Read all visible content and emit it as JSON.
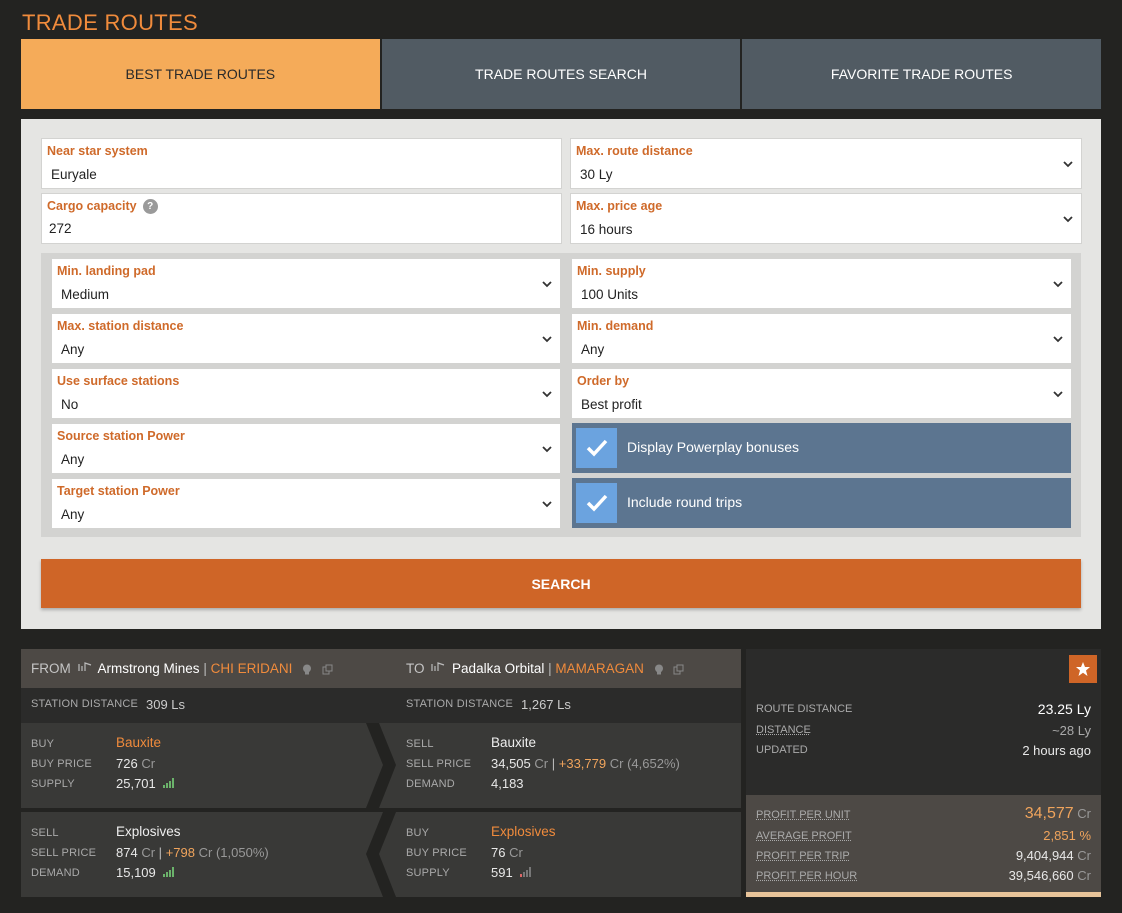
{
  "page_title": "TRADE ROUTES",
  "tabs": [
    {
      "label": "BEST TRADE ROUTES",
      "active": true
    },
    {
      "label": "TRADE ROUTES SEARCH",
      "active": false
    },
    {
      "label": "FAVORITE TRADE ROUTES",
      "active": false
    }
  ],
  "form": {
    "near_star_system": {
      "label": "Near star system",
      "value": "Euryale"
    },
    "max_route_distance": {
      "label": "Max. route distance",
      "value": "30 Ly"
    },
    "cargo_capacity": {
      "label": "Cargo capacity",
      "value": "272",
      "help": "?"
    },
    "max_price_age": {
      "label": "Max. price age",
      "value": "16 hours"
    },
    "min_landing_pad": {
      "label": "Min. landing pad",
      "value": "Medium"
    },
    "min_supply": {
      "label": "Min. supply",
      "value": "100 Units"
    },
    "max_station_distance": {
      "label": "Max. station distance",
      "value": "Any"
    },
    "min_demand": {
      "label": "Min. demand",
      "value": "Any"
    },
    "use_surface_stations": {
      "label": "Use surface stations",
      "value": "No"
    },
    "order_by": {
      "label": "Order by",
      "value": "Best profit"
    },
    "source_station_power": {
      "label": "Source station Power",
      "value": "Any"
    },
    "target_station_power": {
      "label": "Target station Power",
      "value": "Any"
    },
    "display_powerplay": {
      "label": "Display Powerplay bonuses",
      "checked": true
    },
    "include_round_trips": {
      "label": "Include round trips",
      "checked": true
    },
    "search_label": "SEARCH"
  },
  "route": {
    "from": {
      "prefix": "FROM",
      "station": "Armstrong Mines",
      "system": "CHI ERIDANI",
      "distance_label": "STATION DISTANCE",
      "distance": "309 Ls"
    },
    "to": {
      "prefix": "TO",
      "station": "Padalka Orbital",
      "system": "MAMARAGAN",
      "distance_label": "STATION DISTANCE",
      "distance": "1,267 Ls"
    },
    "leg1": {
      "left": {
        "action": "BUY",
        "commodity": "Bauxite",
        "price_label": "BUY PRICE",
        "price": "726",
        "amount_label": "SUPPLY",
        "amount": "25,701"
      },
      "right": {
        "action": "SELL",
        "commodity": "Bauxite",
        "price_label": "SELL PRICE",
        "price": "34,505",
        "profit": "+33,779",
        "profit_pct": "(4,652%)",
        "amount_label": "DEMAND",
        "amount": "4,183"
      }
    },
    "leg2": {
      "left": {
        "action": "SELL",
        "commodity": "Explosives",
        "price_label": "SELL PRICE",
        "price": "874",
        "profit": "+798",
        "profit_pct": "(1,050%)",
        "amount_label": "DEMAND",
        "amount": "15,109"
      },
      "right": {
        "action": "BUY",
        "commodity": "Explosives",
        "price_label": "BUY PRICE",
        "price": "76",
        "amount_label": "SUPPLY",
        "amount": "591"
      }
    },
    "currency": "Cr",
    "summary": {
      "route_distance_label": "ROUTE DISTANCE",
      "route_distance": "23.25 Ly",
      "distance_label": "DISTANCE",
      "distance": "~28 Ly",
      "updated_label": "UPDATED",
      "updated": "2 hours ago",
      "profit_per_unit_label": "PROFIT PER UNIT",
      "profit_per_unit": "34,577",
      "average_profit_label": "AVERAGE PROFIT",
      "average_profit": "2,851 %",
      "profit_per_trip_label": "PROFIT PER TRIP",
      "profit_per_trip": "9,404,944",
      "profit_per_hour_label": "PROFIT PER HOUR",
      "profit_per_hour": "39,546,660"
    }
  },
  "colors": {
    "accent": "#f08b3c",
    "active_tab": "#f5ab59",
    "button": "#cf6527",
    "checkbox_bg": "#5c7590"
  }
}
